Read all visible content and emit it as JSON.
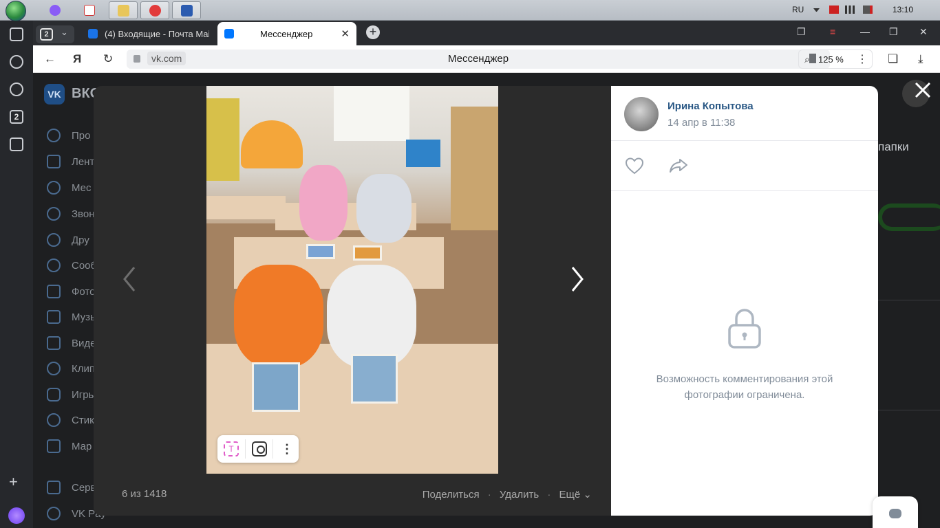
{
  "taskbar": {
    "language": "RU",
    "time": "13:10",
    "active_count": "2"
  },
  "rail": {
    "tab_count": "2"
  },
  "tabs": [
    {
      "title": "(4) Входящие - Почта Mail",
      "active": false
    },
    {
      "title": "Мессенджер",
      "active": true
    }
  ],
  "tab_counter": "2",
  "address": {
    "domain": "vk.com",
    "title": "Мессенджер",
    "zoom": "125 %"
  },
  "vk": {
    "logo_text": "ВКО",
    "sidebar": [
      {
        "label": "Про",
        "icon": "profile-icon"
      },
      {
        "label": "Лент",
        "icon": "feed-icon"
      },
      {
        "label": "Мес",
        "icon": "messages-icon"
      },
      {
        "label": "Звон",
        "icon": "calls-icon"
      },
      {
        "label": "Дру",
        "icon": "friends-icon"
      },
      {
        "label": "Сооб",
        "icon": "communities-icon"
      },
      {
        "label": "Фото",
        "icon": "photos-icon"
      },
      {
        "label": "Музы",
        "icon": "music-icon"
      },
      {
        "label": "Виде",
        "icon": "video-icon"
      },
      {
        "label": "Клип",
        "icon": "clips-icon"
      },
      {
        "label": "Игры",
        "icon": "games-icon"
      },
      {
        "label": "Стик",
        "icon": "stickers-icon"
      },
      {
        "label": "Мар",
        "icon": "market-icon"
      },
      {
        "label": "Серв",
        "icon": "services-icon"
      },
      {
        "label": "VK Pay",
        "icon": "vkpay-icon"
      }
    ],
    "bg_right_text": "папки"
  },
  "viewer": {
    "counter": "6 из 1418",
    "share": "Поделиться",
    "delete": "Удалить",
    "more": "Ещё",
    "text_tool": "T"
  },
  "panel": {
    "author": "Ирина Копытова",
    "date": "14 апр в 11:38",
    "locked_message": "Возможность комментирования этой фотографии ограничена."
  }
}
